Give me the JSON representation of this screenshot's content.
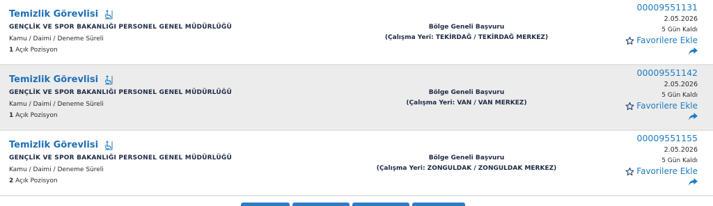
{
  "listings": [
    {
      "title": "Temizlik Görevlisi",
      "accessibility_icon": "wheelchair-icon",
      "organization": "GENÇLİK VE SPOR BAKANLIĞI PERSONEL GENEL MÜDÜRLÜĞÜ",
      "employment_type": "Kamu / Daimi / Deneme Süreli",
      "open_positions_count": "1",
      "open_positions_label": "Açık Pozisyon",
      "application_type": "Bölge Geneli Başvuru",
      "location": "(Çalışma Yeri: TEKİRDAĞ / TEKİRDAĞ MERKEZ)",
      "listing_number": "00009551131",
      "date": "2.05.2026",
      "days_left": "5 Gün Kaldı",
      "favorite_label": "Favorilere Ekle"
    },
    {
      "title": "Temizlik Görevlisi",
      "accessibility_icon": "wheelchair-icon",
      "organization": "GENÇLİK VE SPOR BAKANLIĞI PERSONEL GENEL MÜDÜRLÜĞÜ",
      "employment_type": "Kamu / Daimi / Deneme Süreli",
      "open_positions_count": "1",
      "open_positions_label": "Açık Pozisyon",
      "application_type": "Bölge Geneli Başvuru",
      "location": "(Çalışma Yeri: VAN / VAN MERKEZ)",
      "listing_number": "00009551142",
      "date": "2.05.2026",
      "days_left": "5 Gün Kaldı",
      "favorite_label": "Favorilere Ekle"
    },
    {
      "title": "Temizlik Görevlisi",
      "accessibility_icon": "wheelchair-icon",
      "organization": "GENÇLİK VE SPOR BAKANLIĞI PERSONEL GENEL MÜDÜRLÜĞÜ",
      "employment_type": "Kamu / Daimi / Deneme Süreli",
      "open_positions_count": "2",
      "open_positions_label": "Açık Pozisyon",
      "application_type": "Bölge Geneli Başvuru",
      "location": "(Çalışma Yeri: ZONGULDAK / ZONGULDAK MERKEZ)",
      "listing_number": "00009551155",
      "date": "2.05.2026",
      "days_left": "5 Gün Kaldı",
      "favorite_label": "Favorilere Ekle"
    }
  ],
  "colors": {
    "link_blue": "#1d7bc2",
    "title_blue": "#1d6fb6",
    "dark_text": "#1d2a44",
    "row_shade": "#ececec",
    "pagination_blue": "#2e7bc4"
  },
  "icons": {
    "favorite": "star-outline-icon",
    "share": "share-arrow-icon"
  }
}
